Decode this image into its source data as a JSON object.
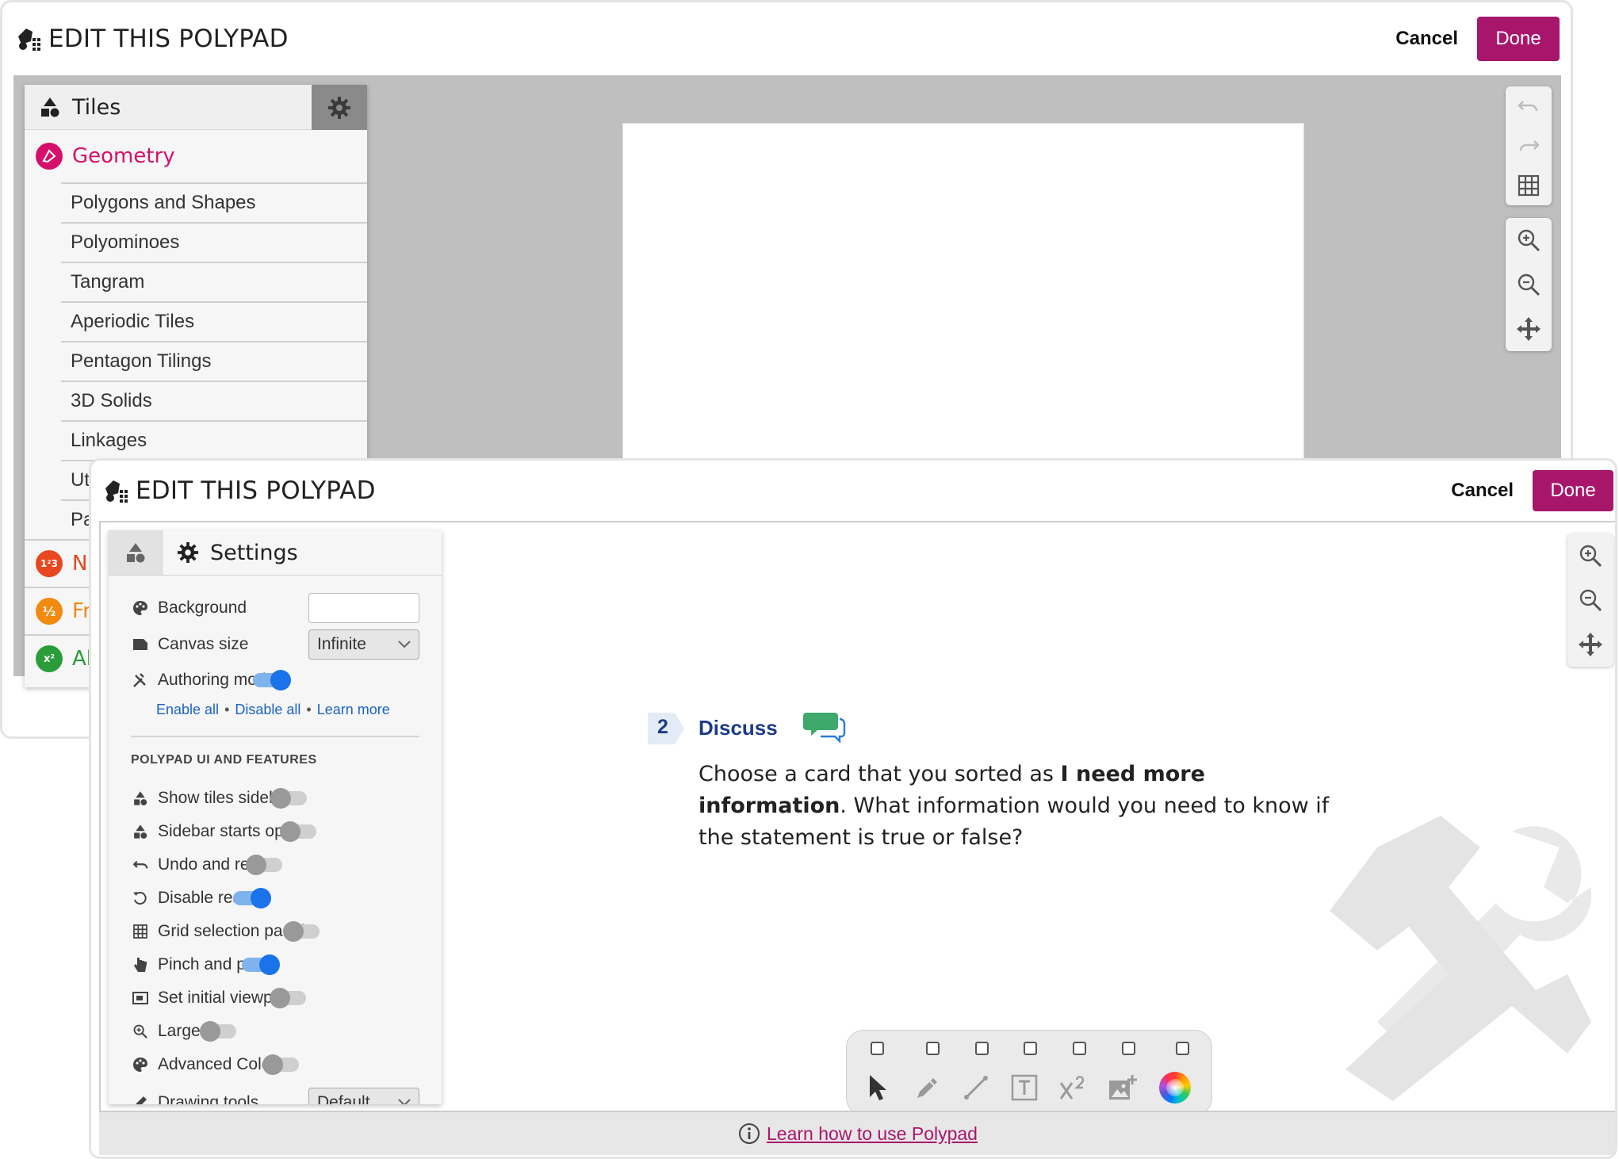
{
  "back_window": {
    "title": "EDIT THIS POLYPAD",
    "cancel_label": "Cancel",
    "done_label": "Done",
    "sidebar": {
      "header_label": "Tiles",
      "category": "Geometry",
      "items": [
        "Polygons and Shapes",
        "Polyominoes",
        "Tangram",
        "Aperiodic Tiles",
        "Pentagon Tilings",
        "3D Solids",
        "Linkages",
        "Ut",
        "Pa"
      ],
      "other_categories": [
        {
          "label": "N",
          "icon_text": "1²3",
          "color": "#e8471f"
        },
        {
          "label": "Fr",
          "icon_text": "½",
          "color": "#f28a10"
        },
        {
          "label": "Al",
          "icon_text": "x²",
          "color": "#2a9d3a"
        }
      ]
    }
  },
  "front_window": {
    "title": "EDIT THIS POLYPAD",
    "cancel_label": "Cancel",
    "done_label": "Done",
    "settings": {
      "tab_label": "Settings",
      "background_label": "Background",
      "canvas_size_label": "Canvas size",
      "canvas_size_value": "Infinite",
      "authoring_mode_label": "Authoring mode",
      "authoring_mode_on": true,
      "links": {
        "enable_all": "Enable all",
        "disable_all": "Disable all",
        "learn_more": "Learn more",
        "separator": "•"
      },
      "section_title": "POLYPAD UI AND FEATURES",
      "features": [
        {
          "label": "Show tiles sidebar",
          "on": false,
          "icon": "shapes-icon"
        },
        {
          "label": "Sidebar starts open",
          "on": false,
          "icon": "shapes-icon"
        },
        {
          "label": "Undo and redo",
          "on": false,
          "icon": "undo-icon"
        },
        {
          "label": "Disable reset",
          "on": true,
          "icon": "reset-icon"
        },
        {
          "label": "Grid selection panel",
          "on": false,
          "icon": "grid-icon"
        },
        {
          "label": "Pinch and pan",
          "on": true,
          "icon": "hand-icon"
        },
        {
          "label": "Set initial viewport",
          "on": false,
          "icon": "viewport-icon"
        },
        {
          "label": "Large UI",
          "on": false,
          "icon": "zoom-icon"
        },
        {
          "label": "Advanced Colors",
          "on": false,
          "icon": "palette-icon"
        }
      ],
      "drawing_tools_label": "Drawing tools",
      "drawing_tools_value": "Default"
    },
    "discuss": {
      "number": "2",
      "title": "Discuss",
      "text_before": "Choose a card that you sorted as ",
      "text_bold": "I need more information",
      "text_after": ". What information would you need to know if the statement is true or false?"
    },
    "footer": {
      "link_text": "Learn how to use Polypad"
    }
  },
  "colors": {
    "brand": "#a8166b",
    "geometry": "#d6106a",
    "link": "#1a63c9",
    "toggle_on": "#1a73e8",
    "discuss_blue": "#1b3b8a",
    "discuss_green": "#3fa96b"
  }
}
